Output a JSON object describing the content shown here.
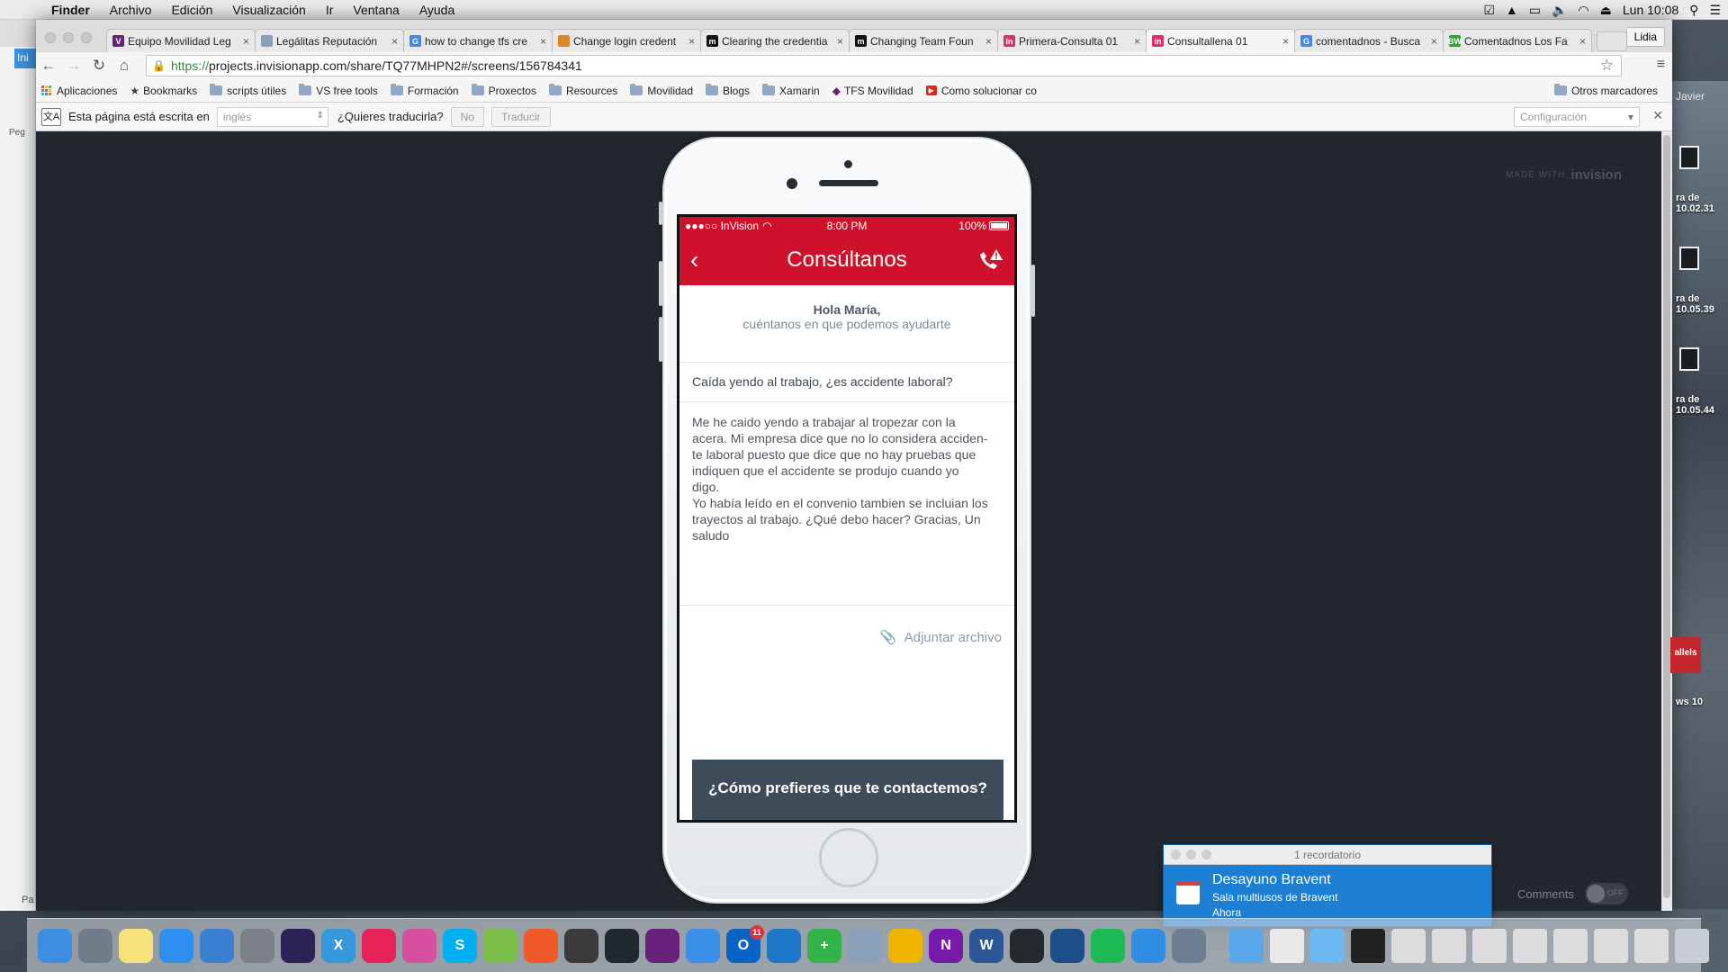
{
  "menubar": {
    "apple": "",
    "items": [
      "Finder",
      "Archivo",
      "Edición",
      "Visualización",
      "Ir",
      "Ventana",
      "Ayuda"
    ],
    "clock": "Lun 10:08"
  },
  "background_window": {
    "tab_label": "Ini",
    "side_label": "Peg",
    "bottom_label": "Pa"
  },
  "browser": {
    "tabs": [
      {
        "label": "Equipo Movilidad Leg",
        "favicon_color": "#68217a",
        "favicon_letter": "V"
      },
      {
        "label": "Legálitas Reputación",
        "favicon_color": "#8aa0b8",
        "favicon_letter": ""
      },
      {
        "label": "how to change tfs cre",
        "favicon_color": "#4285f4",
        "favicon_letter": "G"
      },
      {
        "label": "Change login credent",
        "favicon_color": "#e0842a",
        "favicon_letter": ""
      },
      {
        "label": "Clearing the credentia",
        "favicon_color": "#111111",
        "favicon_letter": "m"
      },
      {
        "label": "Changing Team Foun",
        "favicon_color": "#111111",
        "favicon_letter": "m"
      },
      {
        "label": "Primera-Consulta 01",
        "favicon_color": "#e0306a",
        "favicon_letter": "in"
      },
      {
        "label": "Consultallena 01",
        "favicon_color": "#e0306a",
        "favicon_letter": "in"
      },
      {
        "label": "comentadnos - Busca",
        "favicon_color": "#4285f4",
        "favicon_letter": "G"
      },
      {
        "label": "Comentadnos Los Fa",
        "favicon_color": "#2aa52a",
        "favicon_letter": "BW"
      }
    ],
    "active_tab_index": 7,
    "profile": "Lidia",
    "url_scheme": "https://",
    "url_rest": "projects.invisionapp.com/share/TQ77MHPN2#/screens/156784341",
    "bookmarks": [
      {
        "label": "Aplicaciones",
        "type": "apps"
      },
      {
        "label": "Bookmarks",
        "type": "star"
      },
      {
        "label": "scripts útiles",
        "type": "folder"
      },
      {
        "label": "VS free tools",
        "type": "folder"
      },
      {
        "label": "Formación",
        "type": "folder"
      },
      {
        "label": "Proxectos",
        "type": "folder"
      },
      {
        "label": "Resources",
        "type": "folder"
      },
      {
        "label": "Movilidad",
        "type": "folder"
      },
      {
        "label": "Blogs",
        "type": "folder"
      },
      {
        "label": "Xamarin",
        "type": "folder"
      },
      {
        "label": "TFS Movilidad",
        "type": "vs"
      },
      {
        "label": "Como solucionar co",
        "type": "youtube"
      }
    ],
    "other_bookmarks": "Otros marcadores",
    "translate": {
      "prompt": "Esta página está escrita en",
      "language": "inglés",
      "question": "¿Quieres traducirla?",
      "no": "No",
      "translate": "Traducir",
      "settings": "Configuración"
    }
  },
  "invision": {
    "made_with": "MADE WITH",
    "brand": "invision",
    "comments": "Comments",
    "toggle": "OFF"
  },
  "app": {
    "status": {
      "carrier": "●●●○○ InVision",
      "time": "8:00 PM",
      "battery": "100%"
    },
    "title": "Consúltanos",
    "greeting_name": "Hola María,",
    "greeting_sub": "cuéntanos en que podemos ayudarte",
    "subject": "Caída yendo al trabajo, ¿es accidente laboral?",
    "message_lines": [
      "Me he caido yendo a trabajar al tropezar con la",
      "acera. Mi empresa dice que no lo considera acciden-",
      "te laboral puesto que dice que no hay pruebas que",
      "indiquen que el accidente se produjo cuando yo",
      "digo.",
      "Yo había leído en el convenio tambien se incluian los",
      "trayectos al trabajo. ¿Qué debo hacer? Gracias, Un",
      "saludo"
    ],
    "attach": "Adjuntar archivo",
    "contact_button": "¿Cómo prefieres que te contactemos?"
  },
  "notification": {
    "header": "1 recordatorio",
    "title": "Desayuno Bravent",
    "subtitle": "Sala multiusos de Bravent",
    "when": "Ahora"
  },
  "desktop": {
    "user": "Javier",
    "items": [
      {
        "line1": "ra de",
        "line2": "10.02.31"
      },
      {
        "line1": "ra de",
        "line2": "10.05.39"
      },
      {
        "line1": "ra de",
        "line2": "10.05.44"
      }
    ],
    "parallels_label": "allels",
    "windows_label": "ws 10"
  },
  "dock": {
    "icons": [
      {
        "name": "finder-icon",
        "color": "#3d8ee0",
        "glyph": ""
      },
      {
        "name": "launchpad-icon",
        "color": "#6f7c8a",
        "glyph": ""
      },
      {
        "name": "notes-icon",
        "color": "#f5e27a",
        "glyph": ""
      },
      {
        "name": "app-store-icon",
        "color": "#2f8ff0",
        "glyph": ""
      },
      {
        "name": "xcode-icon",
        "color": "#3a7fd0",
        "glyph": ""
      },
      {
        "name": "system-preferences-icon",
        "color": "#7b7f86",
        "glyph": ""
      },
      {
        "name": "eclipse-icon",
        "color": "#2c2256",
        "glyph": ""
      },
      {
        "name": "xamarin-icon",
        "color": "#3498db",
        "glyph": "X"
      },
      {
        "name": "flickr-icon",
        "color": "#e8235a",
        "glyph": ""
      },
      {
        "name": "color-wheel-icon",
        "color": "#d94fa0",
        "glyph": ""
      },
      {
        "name": "skype-icon",
        "color": "#00aff0",
        "glyph": "S"
      },
      {
        "name": "android-studio-icon",
        "color": "#7bbf4a",
        "glyph": ""
      },
      {
        "name": "pencil-app-icon",
        "color": "#f05a28",
        "glyph": ""
      },
      {
        "name": "compass-icon",
        "color": "#3b3b3b",
        "glyph": ""
      },
      {
        "name": "hacker-icon",
        "color": "#222831",
        "glyph": ""
      },
      {
        "name": "visual-studio-icon",
        "color": "#68217a",
        "glyph": ""
      },
      {
        "name": "mail-app-icon",
        "color": "#3a8fe8",
        "glyph": ""
      },
      {
        "name": "outlook-icon",
        "color": "#0a64c8",
        "glyph": "O",
        "badge": "11"
      },
      {
        "name": "vscode-icon",
        "color": "#1e78c8",
        "glyph": ""
      },
      {
        "name": "add-app-icon",
        "color": "#34b34a",
        "glyph": "+"
      },
      {
        "name": "car-app-icon",
        "color": "#8aa0b8",
        "glyph": ""
      },
      {
        "name": "chrome-icon",
        "color": "#f0b400",
        "glyph": ""
      },
      {
        "name": "onenote-icon",
        "color": "#7719aa",
        "glyph": "N"
      },
      {
        "name": "word-icon",
        "color": "#2b5797",
        "glyph": "W"
      },
      {
        "name": "github-icon",
        "color": "#24292e",
        "glyph": ""
      },
      {
        "name": "sourcetree-icon",
        "color": "#1d4e89",
        "glyph": ""
      },
      {
        "name": "spotify-icon",
        "color": "#1db954",
        "glyph": ""
      },
      {
        "name": "safari-icon",
        "color": "#2f8de4",
        "glyph": ""
      },
      {
        "name": "preview-icon",
        "color": "#6c7f93",
        "glyph": ""
      }
    ],
    "right_icons": [
      {
        "name": "applications-folder-icon",
        "color": "#5aa7ea"
      },
      {
        "name": "document-stack-icon",
        "color": "#e8e8e8"
      },
      {
        "name": "folder-icon",
        "color": "#6bb8f2"
      },
      {
        "name": "terminal-thumb-icon",
        "color": "#222222"
      },
      {
        "name": "screenshot-thumb-1-icon",
        "color": "#dcdcdc"
      },
      {
        "name": "screenshot-thumb-2-icon",
        "color": "#dcdcdc"
      },
      {
        "name": "screenshot-thumb-3-icon",
        "color": "#dcdcdc"
      },
      {
        "name": "screenshot-thumb-4-icon",
        "color": "#dcdcdc"
      },
      {
        "name": "screenshot-thumb-5-icon",
        "color": "#dcdcdc"
      },
      {
        "name": "screenshot-thumb-6-icon",
        "color": "#dcdcdc"
      },
      {
        "name": "screenshot-thumb-7-icon",
        "color": "#dcdcdc"
      },
      {
        "name": "trash-icon",
        "color": "#c9ced4"
      }
    ]
  },
  "colors": {
    "brand_red": "#d0112b",
    "contact_bg": "#3e4c5a",
    "page_bg": "#23272e",
    "notif_blue": "#1c7fd4"
  }
}
